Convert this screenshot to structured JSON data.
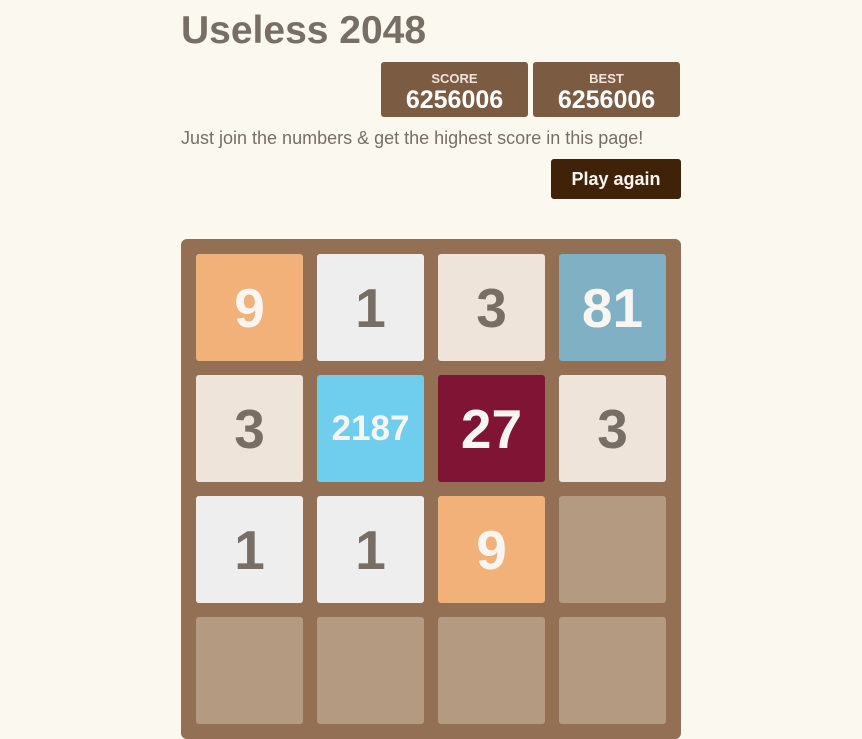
{
  "header": {
    "title": "Useless 2048",
    "intro": "Just join the numbers & get the highest score in this page!",
    "restart_label": "Play again"
  },
  "scores": {
    "score_label": "SCORE",
    "score_value": "6256006",
    "best_label": "BEST",
    "best_value": "6256006"
  },
  "board": {
    "rows": [
      [
        {
          "value": "9",
          "bg": "#f2b179",
          "color": "#f9f6f2"
        },
        {
          "value": "1",
          "bg": "#eeeeee",
          "color": "#776e65"
        },
        {
          "value": "3",
          "bg": "#eee4da",
          "color": "#776e65"
        },
        {
          "value": "81",
          "bg": "#7fb0c4",
          "color": "#f9f6f2"
        }
      ],
      [
        {
          "value": "3",
          "bg": "#eee4da",
          "color": "#776e65"
        },
        {
          "value": "2187",
          "bg": "#6fcdee",
          "color": "#f9f6f2"
        },
        {
          "value": "27",
          "bg": "#7f1435",
          "color": "#f9f6f2"
        },
        {
          "value": "3",
          "bg": "#eee4da",
          "color": "#776e65"
        }
      ],
      [
        {
          "value": "1",
          "bg": "#eeeeee",
          "color": "#776e65"
        },
        {
          "value": "1",
          "bg": "#eeeeee",
          "color": "#776e65"
        },
        {
          "value": "9",
          "bg": "#f2b179",
          "color": "#f9f6f2"
        },
        {
          "value": "",
          "bg": "#b39a80",
          "color": "#776e65"
        }
      ],
      [
        {
          "value": "",
          "bg": "#b39a80",
          "color": "#776e65"
        },
        {
          "value": "",
          "bg": "#b39a80",
          "color": "#776e65"
        },
        {
          "value": "",
          "bg": "#b39a80",
          "color": "#776e65"
        },
        {
          "value": "",
          "bg": "#b39a80",
          "color": "#776e65"
        }
      ]
    ]
  },
  "colors": {
    "background": "#fbf8ef",
    "board": "#936f54",
    "score_box": "#7b5c43",
    "button": "#3f2207",
    "text": "#776e65"
  }
}
